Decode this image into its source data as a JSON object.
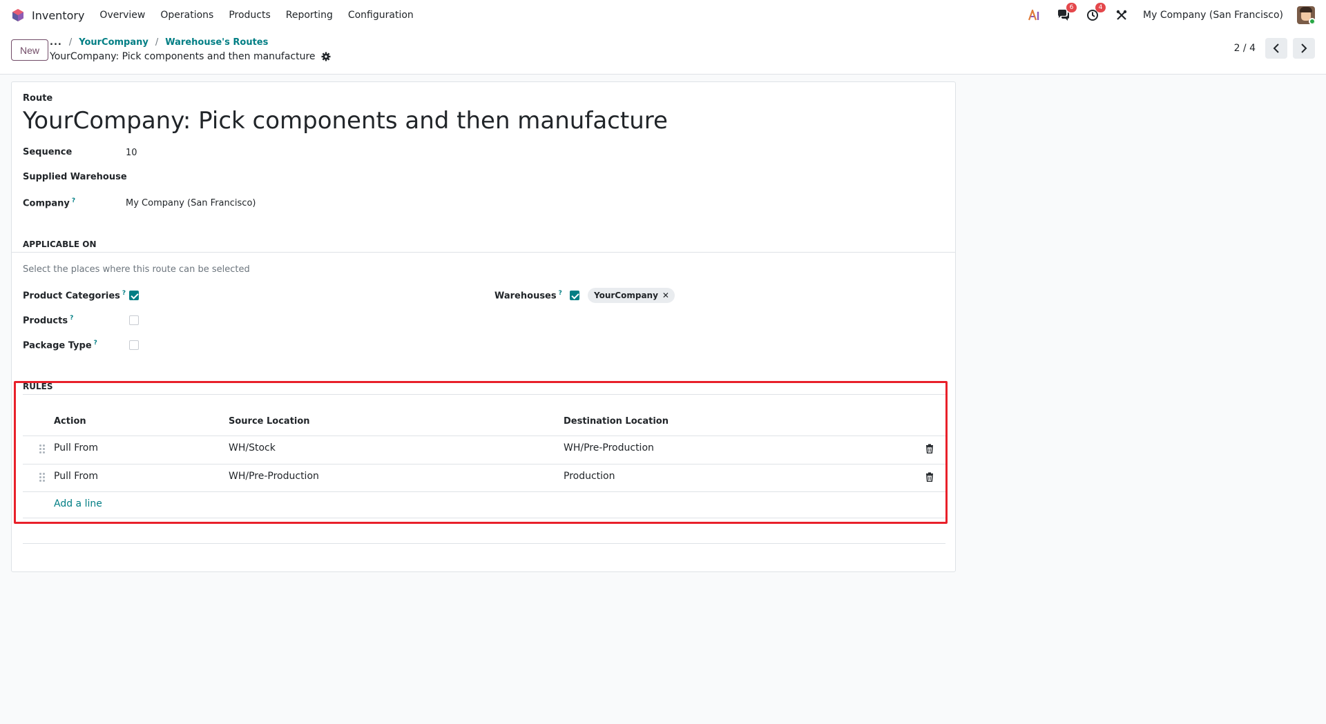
{
  "navbar": {
    "app_name": "Inventory",
    "menu": [
      "Overview",
      "Operations",
      "Products",
      "Reporting",
      "Configuration"
    ],
    "messages_count": "6",
    "activities_count": "4",
    "company": "My Company (San Francisco)"
  },
  "control": {
    "new_label": "New",
    "breadcrumb_more": "...",
    "breadcrumb_sep": "/",
    "breadcrumbs": [
      "YourCompany",
      "Warehouse's Routes"
    ],
    "record_title": "YourCompany: Pick components and then manufacture",
    "pager_value": "2 / 4"
  },
  "form": {
    "route_label": "Route",
    "route_name": "YourCompany: Pick components and then manufacture",
    "sequence_label": "Sequence",
    "sequence_value": "10",
    "supplied_warehouse_label": "Supplied Warehouse",
    "supplied_warehouse_value": "",
    "company_label": "Company",
    "company_value": "My Company (San Francisco)",
    "help_mark": "?"
  },
  "applicable_on": {
    "title": "APPLICABLE ON",
    "hint": "Select the places where this route can be selected",
    "product_categories_label": "Product Categories",
    "product_categories_checked": true,
    "products_label": "Products",
    "products_checked": false,
    "package_type_label": "Package Type",
    "package_type_checked": false,
    "warehouses_label": "Warehouses",
    "warehouses_checked": true,
    "warehouse_tag": "YourCompany",
    "tag_remove": "✕"
  },
  "rules": {
    "title": "RULES",
    "columns": [
      "Action",
      "Source Location",
      "Destination Location"
    ],
    "rows": [
      {
        "action": "Pull From",
        "source": "WH/Stock",
        "destination": "WH/Pre-Production"
      },
      {
        "action": "Pull From",
        "source": "WH/Pre-Production",
        "destination": "Production"
      }
    ],
    "add_line": "Add a line"
  },
  "colors": {
    "accent": "#017e84",
    "brand": "#714b67",
    "highlight": "#e8202a",
    "badge": "#e4474b"
  },
  "icons": [
    "app-logo-icon",
    "ai-icon",
    "chat-icon",
    "clock-icon",
    "tools-icon",
    "gear-icon",
    "chevron-left-icon",
    "chevron-right-icon",
    "drag-handle-icon",
    "trash-icon"
  ]
}
